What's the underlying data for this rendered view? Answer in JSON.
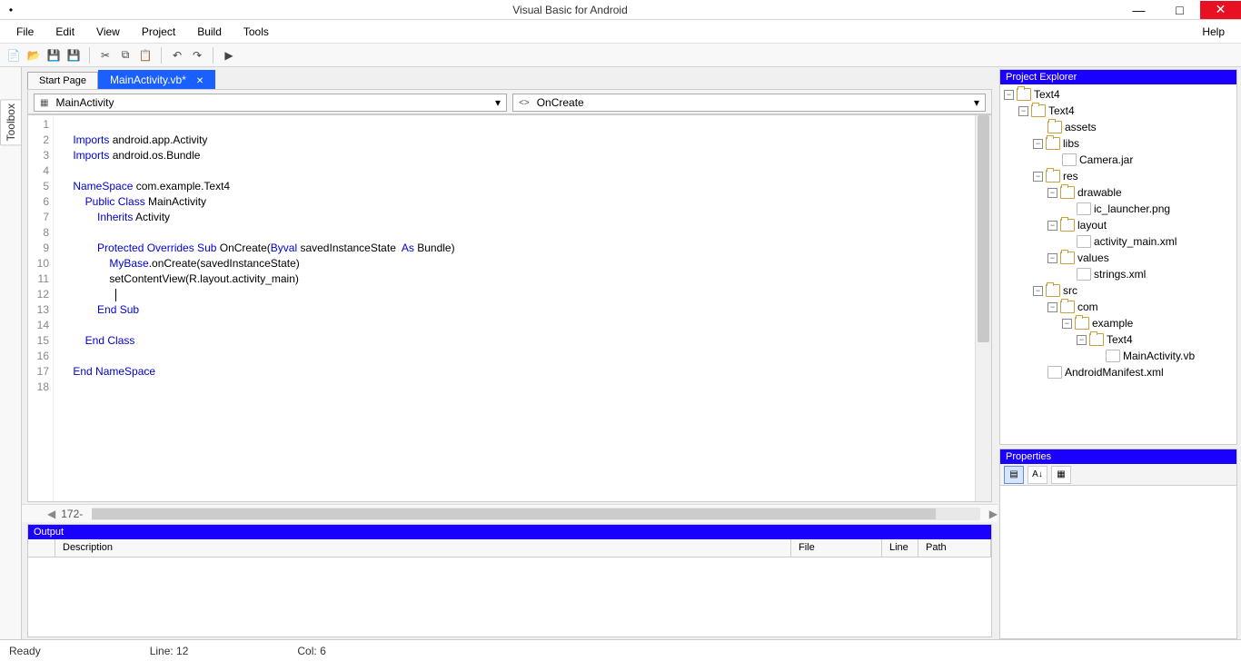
{
  "window": {
    "title": "Visual Basic for Android"
  },
  "menu": {
    "items": [
      "File",
      "Edit",
      "View",
      "Project",
      "Build",
      "Tools"
    ],
    "help": "Help"
  },
  "sidetab": "Toolbox",
  "tabs": {
    "start": "Start Page",
    "active": "MainActivity.vb*"
  },
  "dropdown": {
    "left": "MainActivity",
    "right": "OnCreate"
  },
  "gutter_lines": [
    "1",
    "2",
    "3",
    "4",
    "5",
    "6",
    "7",
    "8",
    "9",
    "10",
    "11",
    "12",
    "13",
    "14",
    "15",
    "16",
    "17",
    "18"
  ],
  "bottom_marker": "172-",
  "code": {
    "l2a": "Imports",
    "l2b": " android.app.Activity",
    "l3a": "Imports",
    "l3b": " android.os.Bundle",
    "l5a": "NameSpace",
    "l5b": " com.example.Text4",
    "l6a": "Public Class",
    "l6b": " MainActivity",
    "l7a": "Inherits",
    "l7b": " Activity",
    "l9a": "Protected Overrides Sub",
    "l9b": " OnCreate(",
    "l9c": "Byval",
    "l9d": " savedInstanceState  ",
    "l9e": "As",
    "l9f": " Bundle)",
    "l10a": "MyBase",
    "l10b": ".onCreate(savedInstanceState)",
    "l11": "setContentView(R.layout.activity_main)",
    "l13": "End Sub",
    "l15": "End Class",
    "l17": "End NameSpace"
  },
  "project_explorer": {
    "title": "Project Explorer",
    "root": "Text4",
    "sub": "Text4",
    "assets": "assets",
    "libs": "libs",
    "camera": "Camera.jar",
    "res": "res",
    "drawable": "drawable",
    "launcher": "ic_launcher.png",
    "layout": "layout",
    "actmain": "activity_main.xml",
    "values": "values",
    "strings": "strings.xml",
    "src": "src",
    "com": "com",
    "example": "example",
    "text4": "Text4",
    "mainactivity": "MainActivity.vb",
    "manifest": "AndroidManifest.xml"
  },
  "properties": {
    "title": "Properties"
  },
  "output": {
    "title": "Output",
    "cols": {
      "desc": "Description",
      "file": "File",
      "line": "Line",
      "path": "Path"
    }
  },
  "status": {
    "ready": "Ready",
    "line": "Line: 12",
    "col": "Col: 6"
  }
}
